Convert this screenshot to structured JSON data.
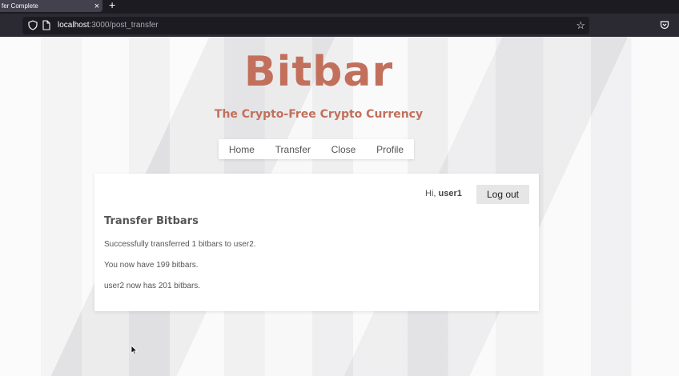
{
  "browser": {
    "tab_title": "fer Complete",
    "tab_close": "×",
    "new_tab": "+",
    "url_host": "localhost",
    "url_path": ":3000/post_transfer",
    "bookmark_star": "☆"
  },
  "site": {
    "logo": "Bitbar",
    "tagline": "The Crypto-Free Crypto Currency",
    "brand_color": "#c2705c",
    "nav": [
      {
        "label": "Home"
      },
      {
        "label": "Transfer"
      },
      {
        "label": "Close"
      },
      {
        "label": "Profile"
      }
    ]
  },
  "card": {
    "greeting_prefix": "Hi, ",
    "username": "user1",
    "logout_label": "Log out",
    "title": "Transfer Bitbars",
    "messages": [
      "Successfully transferred 1 bitbars to user2.",
      "You now have 199 bitbars.",
      "user2 now has 201 bitbars."
    ]
  }
}
